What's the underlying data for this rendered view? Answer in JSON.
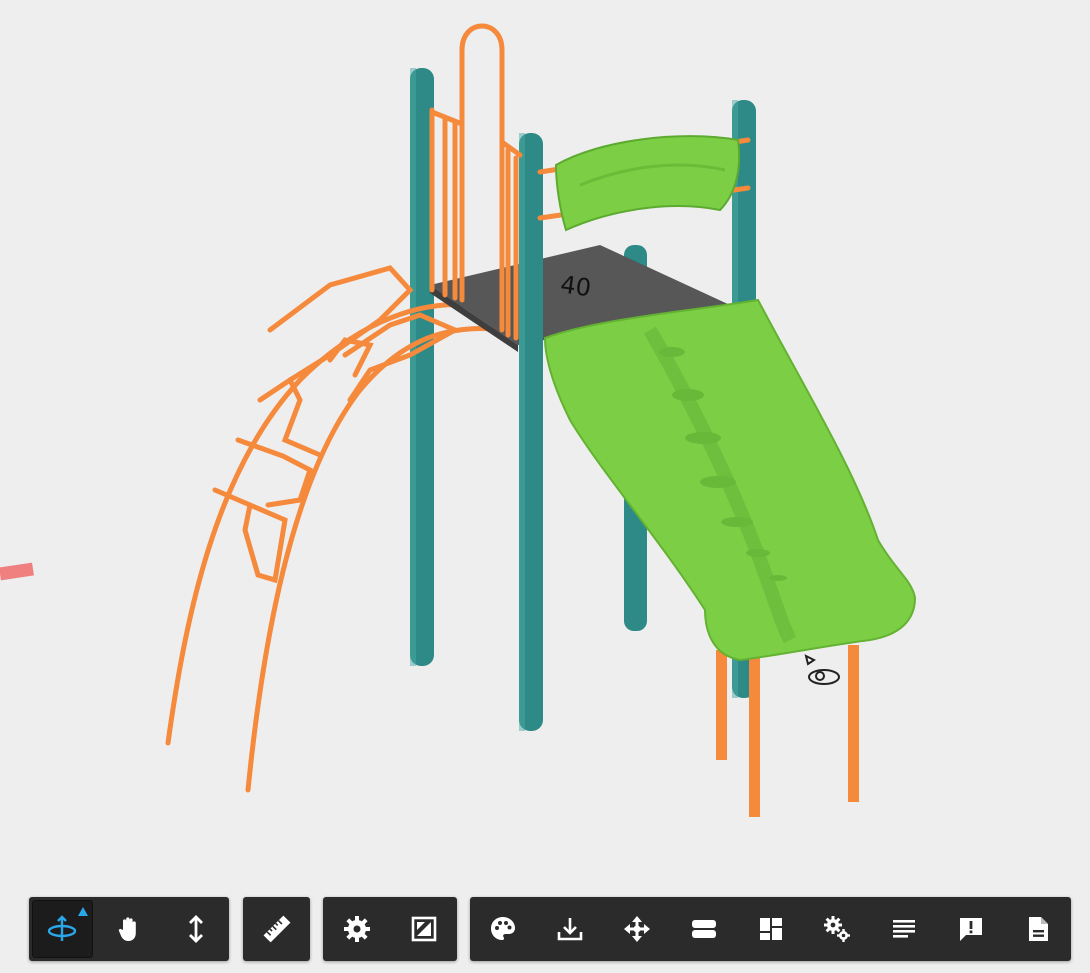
{
  "colors": {
    "background": "#eeeeee",
    "toolbar": "#2b2b2b",
    "active_icon": "#2aa7e8",
    "icon": "#ffffff",
    "post_teal": "#2e8a86",
    "rail_orange": "#f5893c",
    "slide_green": "#7ccf45",
    "deck_gray": "#585858"
  },
  "toolbar": {
    "navigation": [
      {
        "icon": "orbit-icon",
        "active": true
      },
      {
        "icon": "pan-hand-icon",
        "active": false
      },
      {
        "icon": "zoom-updown-icon",
        "active": false
      }
    ],
    "measure": [
      {
        "icon": "ruler-icon",
        "active": false
      }
    ],
    "view": [
      {
        "icon": "gear-icon",
        "active": false
      },
      {
        "icon": "fullscreen-icon",
        "active": false
      }
    ],
    "tools": [
      {
        "icon": "palette-icon",
        "active": false
      },
      {
        "icon": "download-icon",
        "active": false
      },
      {
        "icon": "explode-move-icon",
        "active": false
      },
      {
        "icon": "section-icon",
        "active": false
      },
      {
        "icon": "dashboard-icon",
        "active": false
      },
      {
        "icon": "gears-icon",
        "active": false
      },
      {
        "icon": "text-lines-icon",
        "active": false
      },
      {
        "icon": "feedback-icon",
        "active": false
      },
      {
        "icon": "document-icon",
        "active": false
      }
    ]
  }
}
